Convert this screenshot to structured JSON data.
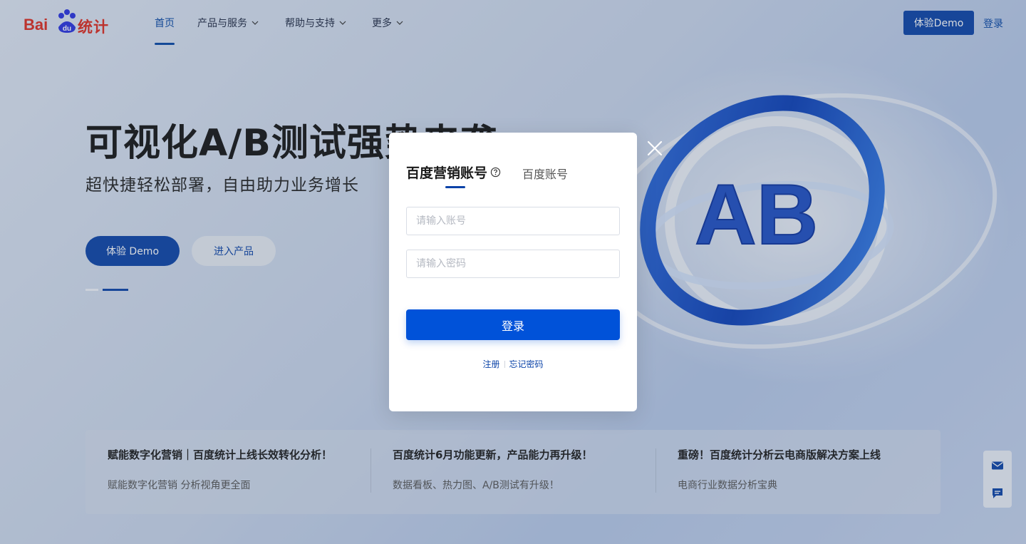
{
  "nav": {
    "logo_bai": "Bai",
    "logo_du": "du",
    "logo_tongji": "统计",
    "items": [
      {
        "label": "首页",
        "active": true
      },
      {
        "label": "产品与服务",
        "has_dropdown": true
      },
      {
        "label": "帮助与支持",
        "has_dropdown": true
      },
      {
        "label": "更多",
        "has_dropdown": true
      }
    ],
    "demo_button": "体验Demo",
    "login_link": "登录"
  },
  "hero": {
    "title": "可视化A/B测试强势来袭",
    "subtitle": "超快捷轻松部署，自由助力业务增长",
    "primary_button": "体验 Demo",
    "secondary_button": "进入产品",
    "art_text": "AB"
  },
  "news": [
    {
      "title": "赋能数字化营销｜百度统计上线长效转化分析！",
      "desc": "赋能数字化营销 分析视角更全面"
    },
    {
      "title": "百度统计6月功能更新，产品能力再升级！",
      "desc": "数据看板、热力图、A/B测试有升级！"
    },
    {
      "title": "重磅！百度统计分析云电商版解决方案上线",
      "desc": "电商行业数据分析宝典"
    }
  ],
  "sidetools": [
    {
      "icon": "mail-icon"
    },
    {
      "icon": "chat-icon"
    }
  ],
  "login_modal": {
    "tab_active": "百度营销账号",
    "tab_inactive": "百度账号",
    "account_placeholder": "请输入账号",
    "password_placeholder": "请输入密码",
    "submit_label": "登录",
    "register_link": "注册",
    "forgot_link": "忘记密码"
  },
  "colors": {
    "brand_blue": "#0b43a8",
    "submit_blue": "#0052d9",
    "logo_red": "#de2b1f"
  }
}
